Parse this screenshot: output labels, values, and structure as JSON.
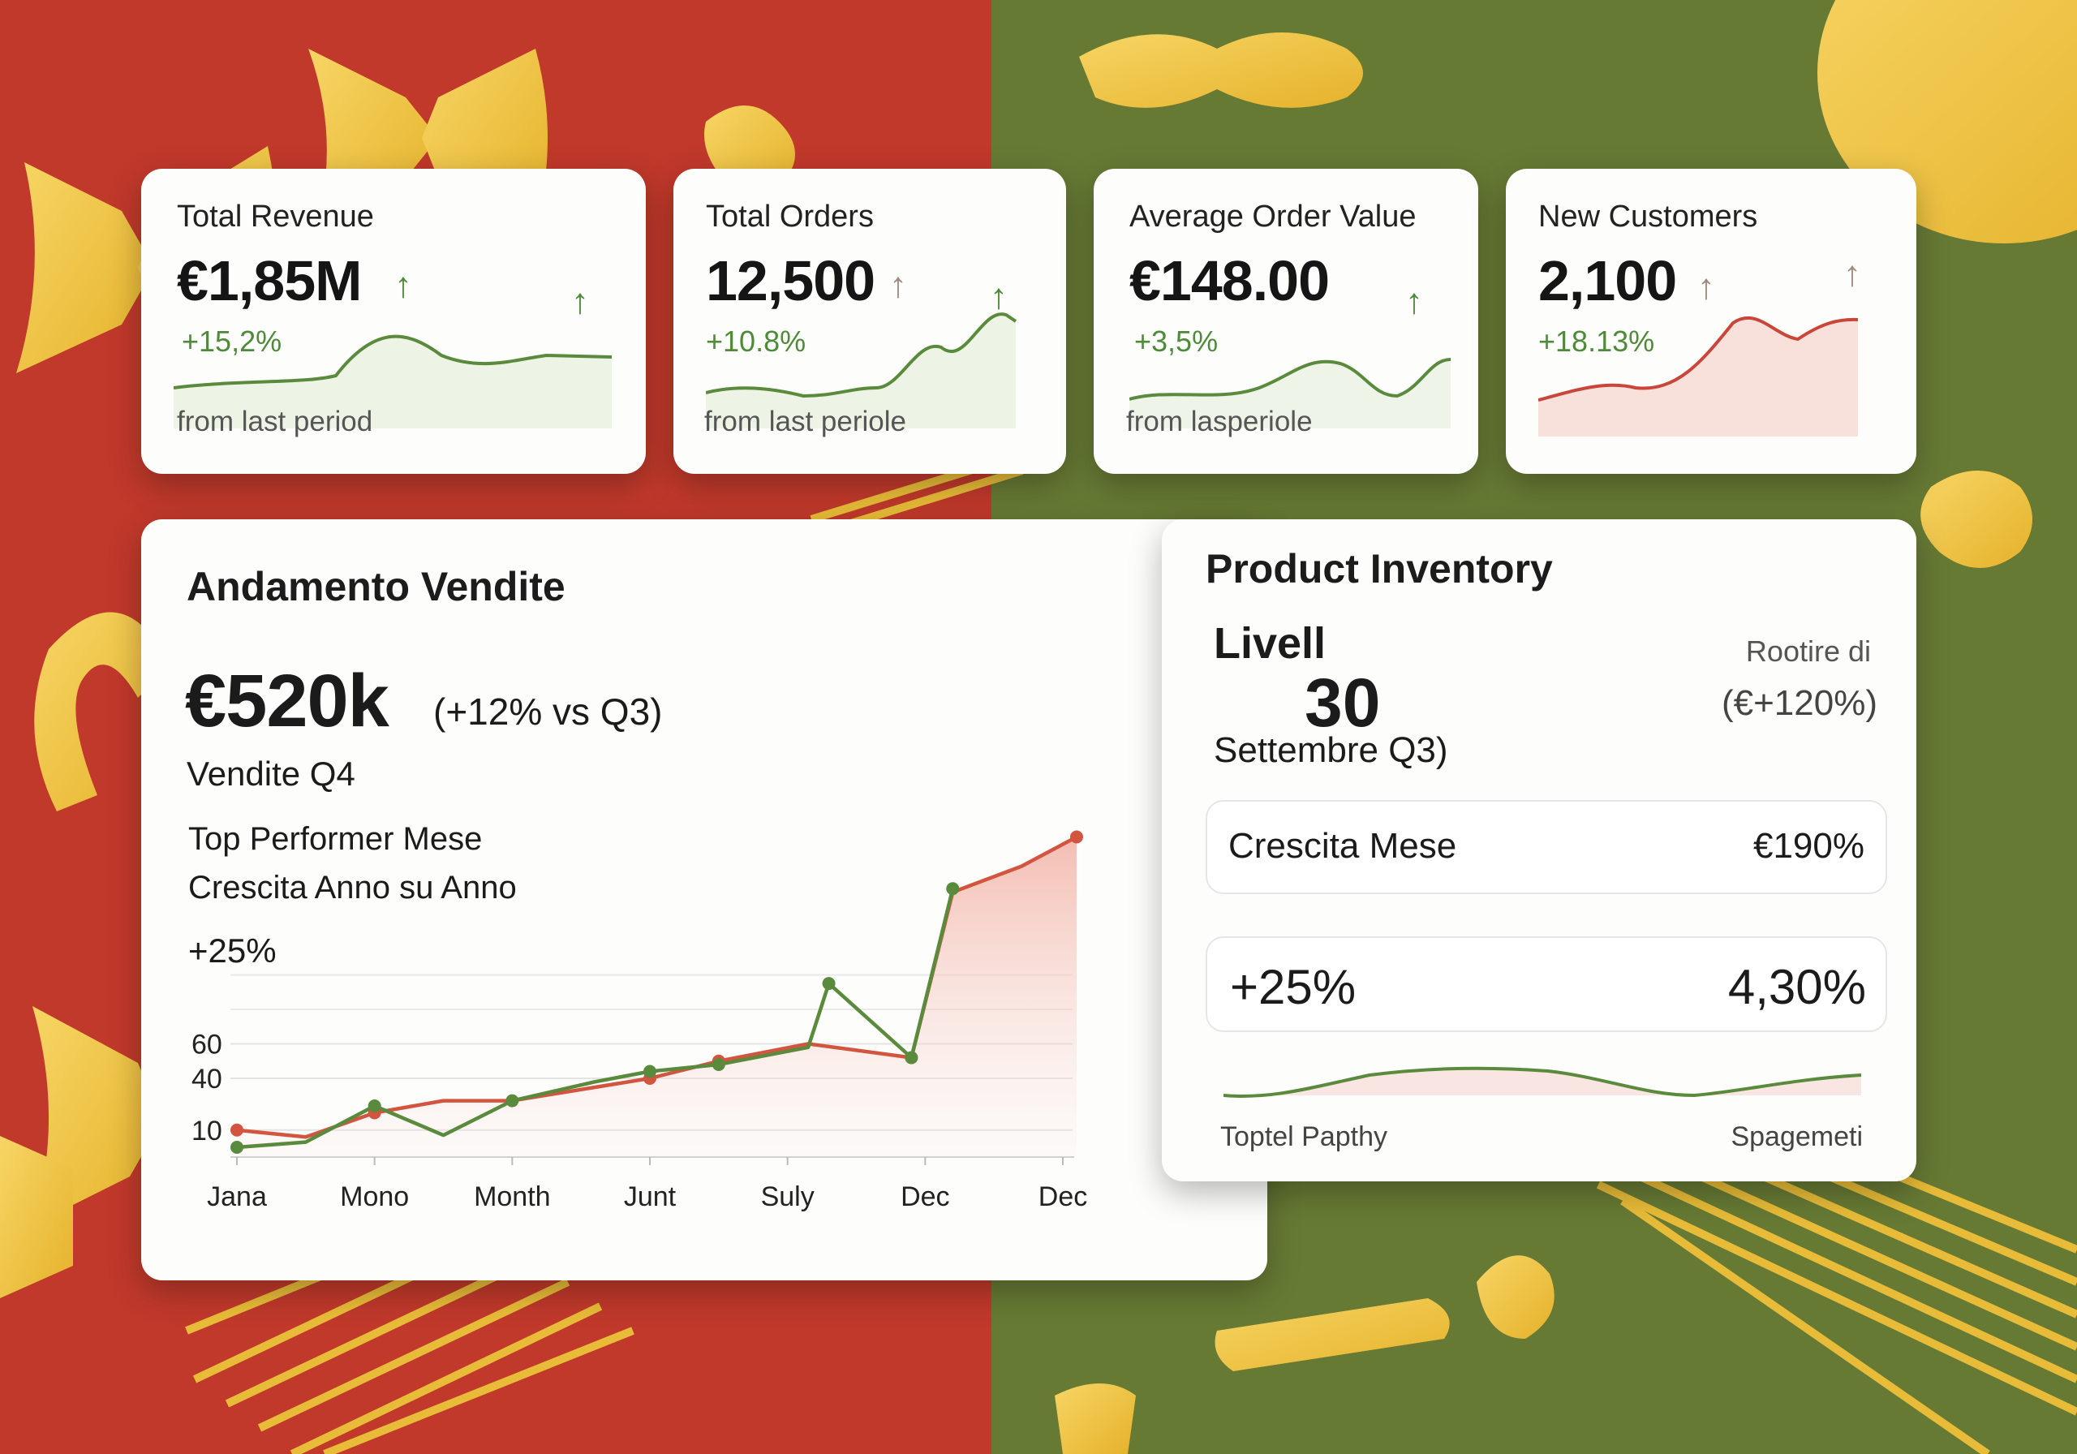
{
  "colors": {
    "bg_red": "#c0392b",
    "bg_green": "#677a34",
    "accent_green": "#5a8a3c",
    "accent_red": "#d25540",
    "muted_brown": "#a08a80",
    "pasta_yellow": "#f2c744"
  },
  "kpis": [
    {
      "title": "Total Revenue",
      "value": "€1,85M",
      "change": "+15,2%",
      "footnote": "from last period",
      "trend_icon": "arrow-up-icon",
      "color": "#4f8a3a"
    },
    {
      "title": "Total Orders",
      "value": "12,500",
      "change": "+10.8%",
      "footnote": "from last periole",
      "trend_icon": "arrow-up-icon",
      "color": "#4f8a3a"
    },
    {
      "title": "Average Order Value",
      "value": "€148.00",
      "change": "+3,5%",
      "footnote": "from lasperiole",
      "trend_icon": "arrow-up-icon",
      "color": "#4f8a3a"
    },
    {
      "title": "New Customers",
      "value": "2,100",
      "change": "+18.13%",
      "footnote": "",
      "trend_icon": "arrow-up-icon",
      "color": "#c8473a"
    }
  ],
  "sales": {
    "title": "Andamento Vendite",
    "headline": "€520k",
    "headline_compare": "(+12% vs Q3)",
    "subtitle": "Vendite Q4",
    "line1": "Top Performer Mese",
    "line2": "Crescita Anno su Anno",
    "line3": "+25%"
  },
  "chart_data": {
    "type": "line",
    "x": [
      "Jana",
      "Mono",
      "Month",
      "Junt",
      "Suly",
      "Dec",
      "Dec"
    ],
    "yticks": [
      10,
      40,
      60
    ],
    "ylim": [
      0,
      160
    ],
    "series": [
      {
        "color": "#d25540",
        "area": true,
        "values": [
          {
            "x": 0,
            "y": 10
          },
          {
            "x": 0.5,
            "y": 6
          },
          {
            "x": 1,
            "y": 20
          },
          {
            "x": 1.5,
            "y": 27
          },
          {
            "x": 2,
            "y": 27
          },
          {
            "x": 3,
            "y": 40
          },
          {
            "x": 3.5,
            "y": 50
          },
          {
            "x": 4.15,
            "y": 60
          },
          {
            "x": 4.9,
            "y": 52
          },
          {
            "x": 5.2,
            "y": 148
          },
          {
            "x": 5.7,
            "y": 163
          },
          {
            "x": 6.1,
            "y": 180
          }
        ]
      },
      {
        "color": "#5a8a3c",
        "area": false,
        "values": [
          {
            "x": 0,
            "y": 0
          },
          {
            "x": 0.5,
            "y": 3
          },
          {
            "x": 1,
            "y": 24
          },
          {
            "x": 1.5,
            "y": 7
          },
          {
            "x": 2,
            "y": 27
          },
          {
            "x": 2.6,
            "y": 38
          },
          {
            "x": 3,
            "y": 44
          },
          {
            "x": 3.5,
            "y": 48
          },
          {
            "x": 4.15,
            "y": 58
          },
          {
            "x": 4.3,
            "y": 95
          },
          {
            "x": 4.9,
            "y": 52
          },
          {
            "x": 5.2,
            "y": 150
          }
        ]
      }
    ]
  },
  "inventory": {
    "title": "Product Inventory",
    "level_label": "Livell",
    "level_value": "30",
    "level_sub": "Settembre Q3)",
    "right_label": "Rootire di",
    "right_value": "(€+120%)",
    "row1_label": "Crescita Mese",
    "row1_value": "€190%",
    "row2_left": "+25%",
    "row2_right": "4,30%",
    "foot_left": "Toptel Papthy",
    "foot_right": "Spagemeti"
  }
}
